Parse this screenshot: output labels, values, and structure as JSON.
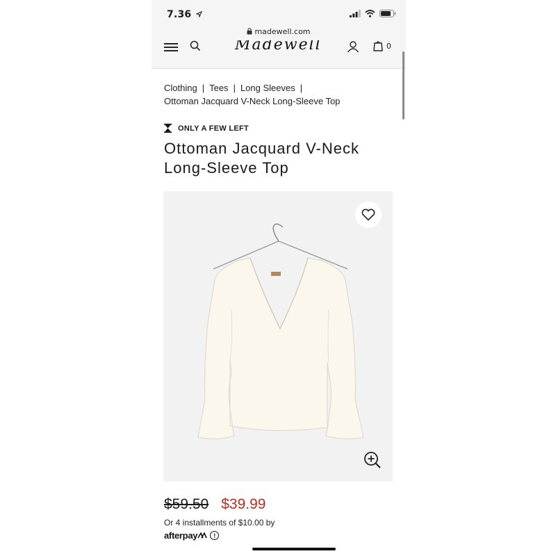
{
  "status_bar": {
    "time": "7.36"
  },
  "browser": {
    "url": "madewell.com"
  },
  "header": {
    "logo": "Madewell",
    "bag_count": "0"
  },
  "breadcrumb": {
    "items": [
      "Clothing",
      "Tees",
      "Long Sleeves"
    ],
    "separator": "|",
    "current": "Ottoman Jacquard V-Neck Long-Sleeve Top"
  },
  "product": {
    "stock_badge": "ONLY A FEW LEFT",
    "title": "Ottoman Jacquard V-Neck Long-Sleeve Top",
    "original_price": "$59.50",
    "sale_price": "$39.99",
    "installments_text": "Or 4 installments of $10.00 by",
    "afterpay_label": "afterpay",
    "info_glyph": "!"
  },
  "colors": {
    "sale": "#b52f1e",
    "image_bg": "#f2f2f2",
    "garment": "#fbf7ec"
  },
  "icons": [
    "location-arrow-icon",
    "signal-icon",
    "wifi-icon",
    "battery-icon",
    "lock-icon",
    "menu-icon",
    "search-icon",
    "account-icon",
    "bag-icon",
    "hourglass-icon",
    "heart-icon",
    "zoom-in-icon",
    "info-icon"
  ]
}
